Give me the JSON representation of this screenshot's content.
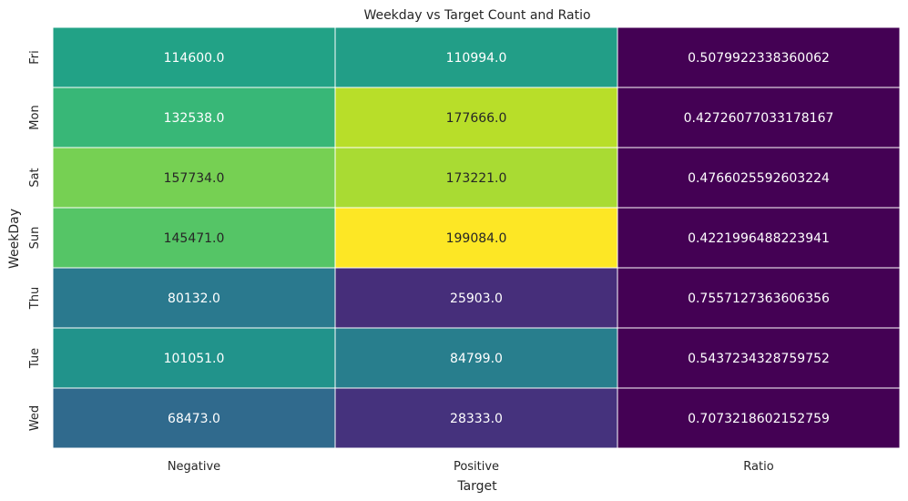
{
  "chart_data": {
    "type": "heatmap",
    "title": "Weekday vs Target Count and Ratio",
    "xlabel": "Target",
    "ylabel": "WeekDay",
    "columns": [
      "Negative",
      "Positive",
      "Ratio"
    ],
    "rows": [
      "Fri",
      "Mon",
      "Sat",
      "Sun",
      "Thu",
      "Tue",
      "Wed"
    ],
    "values": [
      [
        114600.0,
        110994.0,
        0.5079922338360062
      ],
      [
        132538.0,
        177666.0,
        0.42726077033178167
      ],
      [
        157734.0,
        173221.0,
        0.4766025592603224
      ],
      [
        145471.0,
        199084.0,
        0.4221996488223941
      ],
      [
        80132.0,
        25903.0,
        0.7557127363606356
      ],
      [
        101051.0,
        84799.0,
        0.5437234328759752
      ],
      [
        68473.0,
        28333.0,
        0.7073218602152759
      ]
    ],
    "cell_labels": [
      [
        "114600.0",
        "110994.0",
        "0.5079922338360062"
      ],
      [
        "132538.0",
        "177666.0",
        "0.42726077033178167"
      ],
      [
        "157734.0",
        "173221.0",
        "0.4766025592603224"
      ],
      [
        "145471.0",
        "199084.0",
        "0.4221996488223941"
      ],
      [
        "80132.0",
        "25903.0",
        "0.7557127363606356"
      ],
      [
        "101051.0",
        "84799.0",
        "0.5437234328759752"
      ],
      [
        "68473.0",
        "28333.0",
        "0.7073218602152759"
      ]
    ],
    "colormap": "viridis",
    "colorbar": false,
    "grid": false
  }
}
